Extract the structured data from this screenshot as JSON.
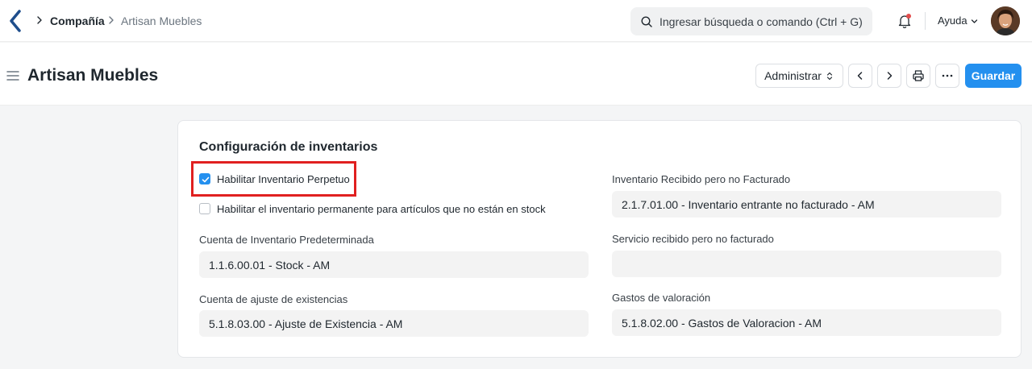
{
  "navbar": {
    "breadcrumbs": [
      "Compañía",
      "Artisan Muebles"
    ],
    "search_placeholder": "Ingresar búsqueda o comando (Ctrl + G)",
    "help_label": "Ayuda",
    "icons": [
      "app-logo-icon",
      "chevron-right-icon",
      "search-icon",
      "bell-icon",
      "chevron-down-icon",
      "avatar"
    ]
  },
  "page": {
    "title": "Artisan Muebles",
    "actions": {
      "admin_label": "Administrar",
      "save_label": "Guardar"
    }
  },
  "section": {
    "title": "Configuración de inventarios",
    "checkboxes": [
      {
        "label": "Habilitar Inventario Perpetuo",
        "checked": true
      },
      {
        "label": "Habilitar el inventario permanente para artículos que no están en stock",
        "checked": false
      }
    ],
    "fields_left": [
      {
        "label": "Cuenta de Inventario Predeterminada",
        "value": "1.1.6.00.01 - Stock - AM"
      },
      {
        "label": "Cuenta de ajuste de existencias",
        "value": "5.1.8.03.00 - Ajuste de Existencia - AM"
      }
    ],
    "fields_right": [
      {
        "label": "Inventario Recibido pero no Facturado",
        "value": "2.1.7.01.00 - Inventario entrante no facturado - AM"
      },
      {
        "label": "Servicio recibido pero no facturado",
        "value": ""
      },
      {
        "label": "Gastos de valoración",
        "value": "5.1.8.02.00 - Gastos de Valoracion - AM"
      }
    ]
  },
  "colors": {
    "primary": "#2490ef",
    "highlight": "#e02020",
    "notification": "#e24c4c"
  }
}
